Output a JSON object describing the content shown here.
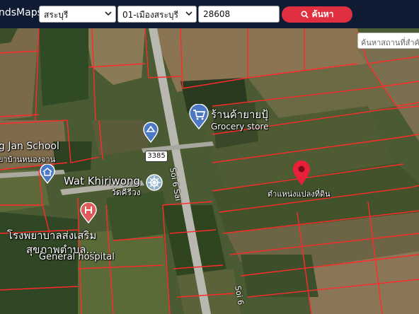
{
  "topbar": {
    "brand": "ndsMaps",
    "province": "สระบุรี",
    "district": "01-เมืองสระบุรี",
    "parcel_number": "28608",
    "search_button": "ค้นหา"
  },
  "map_search": {
    "placeholder": "ค้นหาสถานที่สำคั"
  },
  "map": {
    "places": {
      "school": "g Jan School",
      "school_thai": "ยาบ้านหนองจาน",
      "temple": "Wat Khiriwong",
      "temple_thai": "วัดคีรีวง",
      "grocery_thai": "ร้านค้ายายปุ้",
      "grocery": "Grocery store",
      "hospital_thai_1": "โรงพยาบาลส่งเสริม",
      "hospital_thai_2": "สุขภาพตำบล...",
      "hospital": "General hospital",
      "parcel_marker": "ตำแหน่งแปลงที่ดิน"
    },
    "roads": {
      "soi_upper": "Soi 6 Sai",
      "soi_lower": "Soi 6",
      "route": "3385"
    },
    "icons": [
      "search-icon",
      "shop-icon",
      "school-icon",
      "temple-icon",
      "hospital-icon",
      "location-pin-icon",
      "chevron-down-icon"
    ],
    "colors": {
      "parcel_lines": "#ff2a2a",
      "search_button": "#e0303f",
      "topbar": "#0e1b33"
    }
  }
}
